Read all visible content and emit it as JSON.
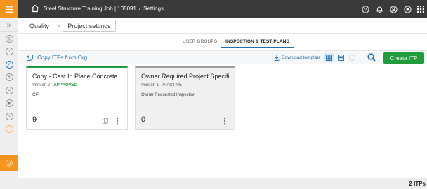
{
  "header": {
    "project": "Steel Structure Training Job | 105091",
    "separator": "/",
    "section": "Settings",
    "icons": [
      "help-icon",
      "bell-icon",
      "user-circle-icon",
      "power-icon",
      "apps-grid-icon"
    ]
  },
  "rail": {
    "collapse_glyph": "»",
    "items": [
      "nav-1",
      "nav-2",
      "nav-3",
      "nav-4",
      "nav-5",
      "nav-6",
      "nav-7",
      "nav-8"
    ]
  },
  "breadcrumb": {
    "root": "Quality",
    "sep": ">",
    "current": "Project settings"
  },
  "tabs": [
    {
      "label": "USER GROUPS"
    },
    {
      "label": "INSPECTION & TEST PLANS"
    }
  ],
  "toolbar": {
    "copy_label": "Copy ITPs from Org",
    "download_label": "Download template",
    "create_label": "Create ITP"
  },
  "cards": [
    {
      "title": "Copy - Cast In Place Concrete",
      "version_prefix": "Version 2 - ",
      "status": "APPROVED",
      "subtitle": "CIP",
      "count": "9"
    },
    {
      "title": "Owner Required Project Specifi...",
      "version_prefix": "Version 1 - ",
      "status": "INACTIVE",
      "subtitle": "Owner Requested Inspection",
      "count": "0"
    }
  ],
  "footer": {
    "total": "2 ITPs"
  },
  "colors": {
    "accent": "#f7941d",
    "primary": "#1e6fb0",
    "success": "#1f9d3a",
    "topbar": "#3a3a3a"
  }
}
